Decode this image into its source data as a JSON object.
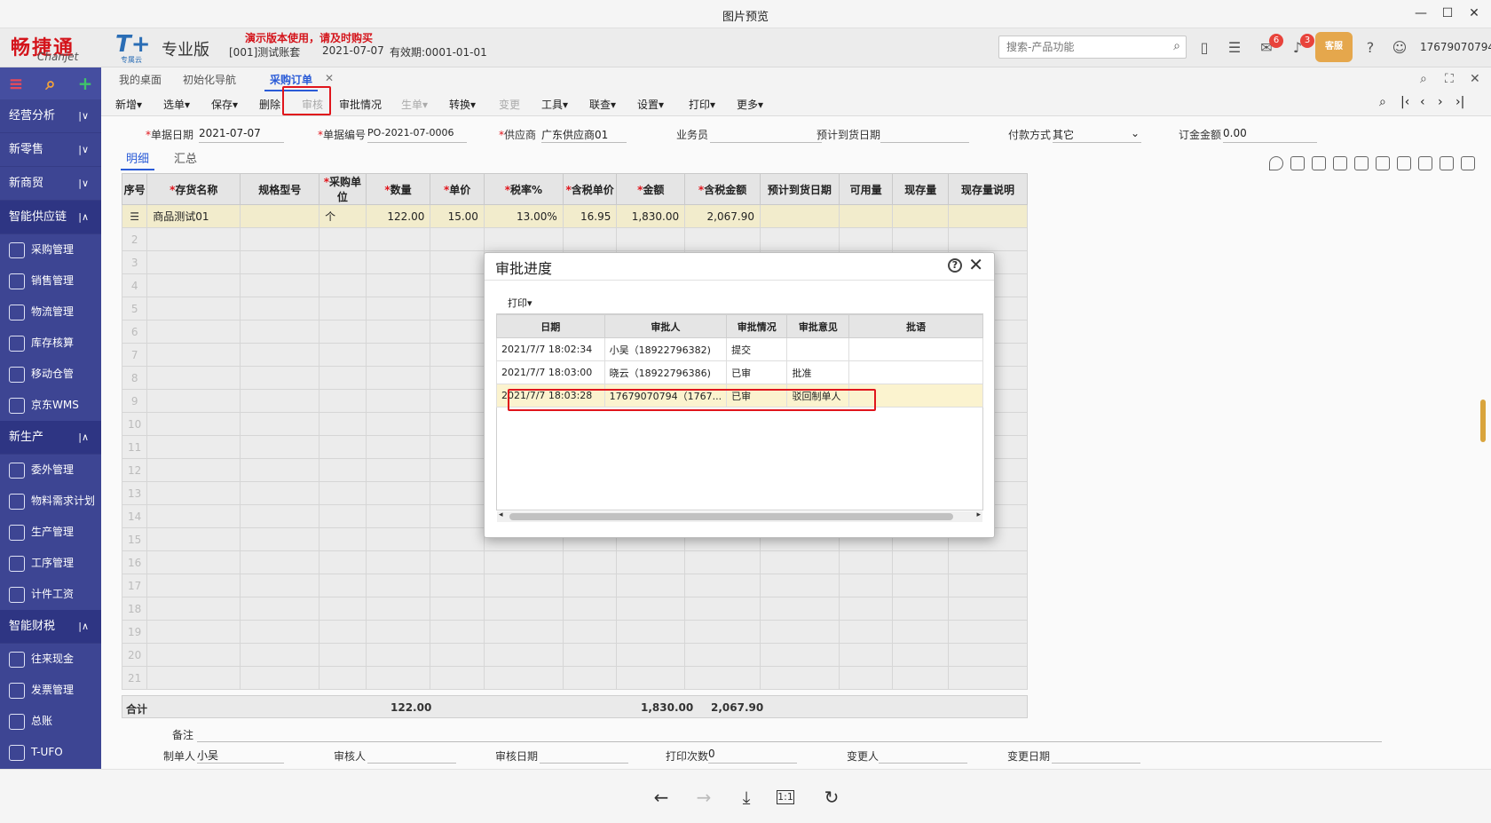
{
  "window": {
    "title": "图片预览"
  },
  "app": {
    "logo_cn": "畅捷通",
    "logo_en": "Chanjet",
    "product_logo": "T+",
    "product_sub": "专属云",
    "edition": "专业版",
    "demo_notice": "演示版本使用，请及时购买",
    "account": "[001]测试账套",
    "date": "2021-07-07",
    "valid": "有效期:0001-01-01",
    "search_placeholder": "搜索-产品功能",
    "badges": {
      "messages": "6",
      "notifications": "3"
    },
    "service_label": "客服",
    "user": "17679070794"
  },
  "sidebar": {
    "groups": [
      {
        "label": "经营分析",
        "arrow": "|∨"
      },
      {
        "label": "新零售",
        "arrow": "|∨"
      },
      {
        "label": "新商贸",
        "arrow": "|∨"
      },
      {
        "label": "智能供应链",
        "arrow": "|∧"
      }
    ],
    "supply_items": [
      "采购管理",
      "销售管理",
      "物流管理",
      "库存核算",
      "移动仓管",
      "京东WMS"
    ],
    "production_group": {
      "label": "新生产",
      "arrow": "|∧"
    },
    "production_items": [
      "委外管理",
      "物料需求计划",
      "生产管理",
      "工序管理",
      "计件工资"
    ],
    "finance_group": {
      "label": "智能财税",
      "arrow": "|∧"
    },
    "finance_items": [
      "往来现金",
      "发票管理",
      "总账",
      "T-UFO"
    ]
  },
  "tabs": [
    "我的桌面",
    "初始化导航",
    "采购订单"
  ],
  "toolbar": {
    "new": "新增",
    "select": "选单",
    "save": "保存",
    "delete": "删除",
    "audit": "审核",
    "audit_status": "审批情况",
    "generate": "生单",
    "convert": "转换",
    "change": "变更",
    "tools": "工具",
    "link": "联查",
    "settings": "设置",
    "print": "打印",
    "more": "更多"
  },
  "form": {
    "date_label": "单据日期",
    "date_value": "2021-07-07",
    "no_label": "单据编号",
    "no_value": "PO-2021-07-0006",
    "supplier_label": "供应商",
    "supplier_value": "广东供应商01",
    "salesman_label": "业务员",
    "expected_label": "预计到货日期",
    "payment_label": "付款方式",
    "payment_value": "其它",
    "amount_label": "订金金额",
    "amount_value": "0.00",
    "subtab_detail": "明细",
    "subtab_summary": "汇总"
  },
  "grid": {
    "columns": [
      "序号",
      "存货名称",
      "规格型号",
      "采购单位",
      "数量",
      "单价",
      "税率%",
      "含税单价",
      "金额",
      "含税金额",
      "预计到货日期",
      "可用量",
      "现存量",
      "现存量说明"
    ],
    "row1": {
      "name": "商品测试01",
      "unit": "个",
      "qty": "122.00",
      "price": "15.00",
      "tax": "13.00%",
      "tax_price": "16.95",
      "amount": "1,830.00",
      "tax_amount": "2,067.90"
    },
    "row_numbers": [
      "2",
      "3",
      "4",
      "5",
      "6",
      "7",
      "8",
      "9",
      "10",
      "11",
      "12",
      "13",
      "14",
      "15",
      "16",
      "17",
      "18",
      "19",
      "20",
      "21"
    ],
    "totals": {
      "label": "合计",
      "qty": "122.00",
      "amount": "1,830.00",
      "tax_amount": "2,067.90"
    }
  },
  "footer": {
    "remark_label": "备注",
    "maker_label": "制单人",
    "maker_value": "小吴",
    "auditor_label": "审核人",
    "audit_date_label": "审核日期",
    "print_count_label": "打印次数",
    "print_count_value": "0",
    "changer_label": "变更人",
    "change_date_label": "变更日期"
  },
  "dialog": {
    "title": "审批进度",
    "print": "打印",
    "columns": [
      "日期",
      "审批人",
      "审批情况",
      "审批意见",
      "批语"
    ],
    "rows": [
      {
        "date": "2021/7/7 18:02:34",
        "approver": "小吴（18922796382)",
        "status": "提交",
        "opinion": "",
        "comment": ""
      },
      {
        "date": "2021/7/7 18:03:00",
        "approver": "晓云（18922796386)",
        "status": "已审",
        "opinion": "批准",
        "comment": ""
      },
      {
        "date": "2021/7/7 18:03:28",
        "approver": "17679070794（1767...",
        "status": "已审",
        "opinion": "驳回制单人",
        "comment": ""
      }
    ]
  },
  "viewer": {
    "zoom_label": "1:1"
  }
}
